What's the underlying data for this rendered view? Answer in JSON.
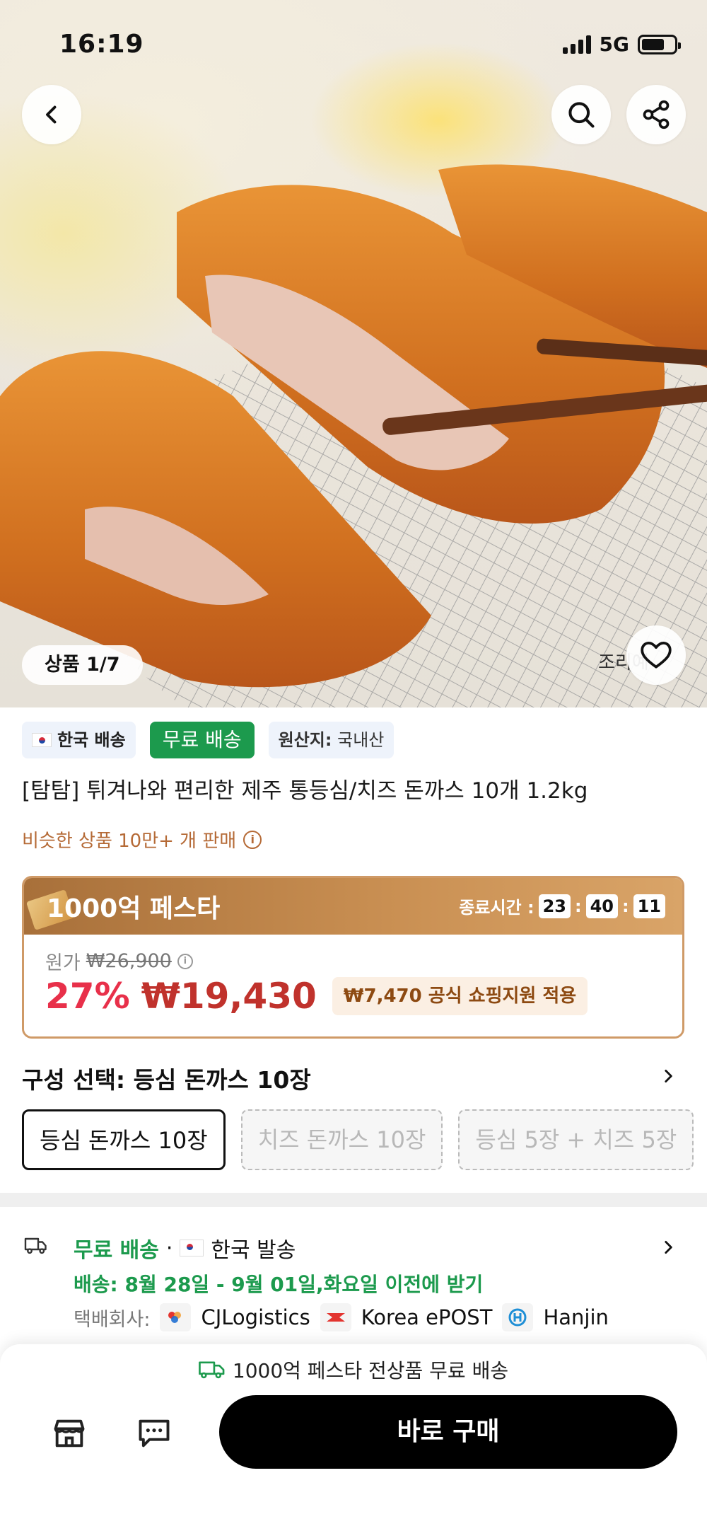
{
  "status_bar": {
    "time": "16:19",
    "network": "5G"
  },
  "hero": {
    "image_counter": "상품 1/7",
    "caption": "조리예"
  },
  "badges": {
    "korea": "한국 배송",
    "free": "무료 배송",
    "origin_label": "원산지:",
    "origin_value": "국내산"
  },
  "product": {
    "title": "[탐탐] 튀겨나와 편리한 제주 통등심/치즈 돈까스 10개 1.2kg",
    "similar_sold": "비슷한 상품 10만+ 개 판매"
  },
  "festa": {
    "title": "1000억 페스타",
    "end_label": "종료시간 :",
    "timer": [
      "23",
      "40",
      "11"
    ],
    "original_label": "원가",
    "original_price": "₩26,900",
    "discount": "27%",
    "price": "₩19,430",
    "support": "₩7,470 공식 쇼핑지원 적용"
  },
  "options": {
    "title": "구성 선택: 등심 돈까스 10장",
    "items": [
      "등심 돈까스 10장",
      "치즈 돈까스 10장",
      "등심 5장 + 치즈 5장"
    ]
  },
  "shipping": {
    "free": "무료 배송",
    "sep": "·",
    "origin": "한국 발송",
    "dates": "배송: 8월 28일 - 9월 01일,화요일 이전에 받기",
    "courier_label": "택배회사:",
    "couriers": [
      "CJLogistics",
      "Korea ePOST",
      "Hanjin"
    ]
  },
  "bottom": {
    "note": "1000억 페스타 전상품 무료 배송",
    "buy": "바로 구매"
  },
  "colors": {
    "green": "#1c9a4d",
    "red": "#e8304a",
    "gold": "#c98f52"
  }
}
